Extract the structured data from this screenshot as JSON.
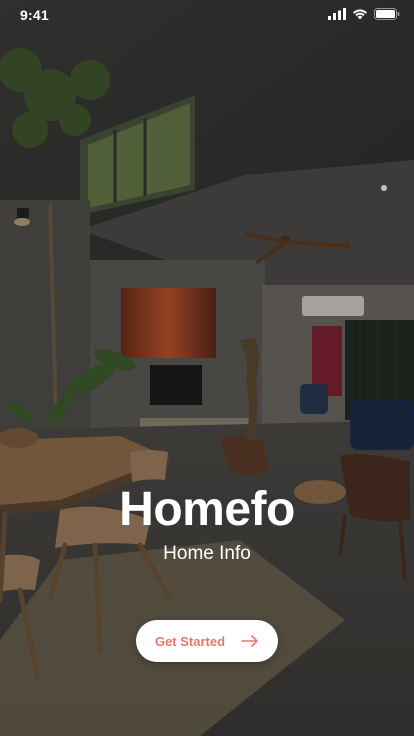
{
  "status_bar": {
    "time": "9:41",
    "icons": [
      "signal-icon",
      "wifi-icon",
      "battery-icon"
    ]
  },
  "app": {
    "title": "Homefo",
    "subtitle": "Home Info"
  },
  "cta": {
    "label": "Get Started",
    "icon": "arrow-right-icon"
  },
  "colors": {
    "accent": "#e8786c",
    "button_bg": "#ffffff",
    "text": "#ffffff"
  }
}
